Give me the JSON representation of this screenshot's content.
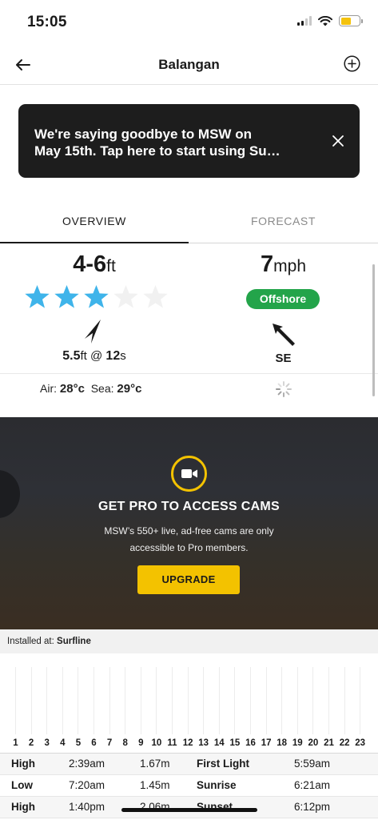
{
  "status_bar": {
    "time": "15:05",
    "battery_level": 0.55,
    "battery_color": "#f4c20d"
  },
  "nav": {
    "title": "Balangan",
    "back_icon": "arrow-left-icon",
    "add_icon": "plus-circle-icon"
  },
  "banner": {
    "text": "We're saying goodbye to MSW on\nMay 15th. Tap here to start using Su…",
    "close_icon": "close-icon"
  },
  "tabs": [
    {
      "label": "OVERVIEW",
      "active": true
    },
    {
      "label": "FORECAST",
      "active": false
    }
  ],
  "surf": {
    "wave_height": "4-6",
    "wave_unit": "ft",
    "rating_stars": 3,
    "rating_max": 5,
    "star_color": "#3fb4ea",
    "swell_size": "5.5",
    "swell_unit": "ft",
    "swell_at": " @ ",
    "swell_period": "12",
    "swell_period_unit": "s"
  },
  "wind": {
    "speed": "7",
    "unit": "mph",
    "type": "Offshore",
    "type_color": "#23a44a",
    "direction": "SE"
  },
  "temps": {
    "air_label": "Air:",
    "air_value": "28°c",
    "sea_label": "Sea:",
    "sea_value": "29°c"
  },
  "cam": {
    "icon": "video-camera-icon",
    "accent_color": "#f3c200",
    "title": "GET PRO TO ACCESS CAMS",
    "subtitle_line1": "MSW’s 550+ live, ad-free cams are only",
    "subtitle_line2": "accessible to Pro members.",
    "button": "UPGRADE"
  },
  "installed": {
    "label": "Installed at:",
    "value": "Surfline"
  },
  "hours": [
    "1",
    "2",
    "3",
    "4",
    "5",
    "6",
    "7",
    "8",
    "9",
    "10",
    "11",
    "12",
    "13",
    "14",
    "15",
    "16",
    "17",
    "18",
    "19",
    "20",
    "21",
    "22",
    "23"
  ],
  "tides": [
    {
      "type": "High",
      "time": "2:39am",
      "height": "1.67m",
      "label": "First Light",
      "value": "5:59am"
    },
    {
      "type": "Low",
      "time": "7:20am",
      "height": "1.45m",
      "label": "Sunrise",
      "value": "6:21am"
    },
    {
      "type": "High",
      "time": "1:40pm",
      "height": "2.06m",
      "label": "Sunset",
      "value": "6:12pm"
    }
  ]
}
